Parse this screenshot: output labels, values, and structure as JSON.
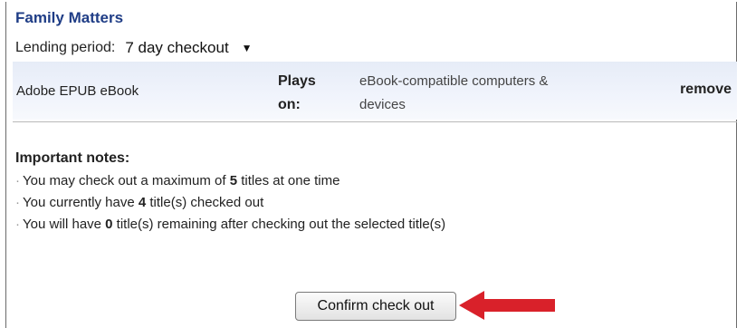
{
  "title": "Family Matters",
  "lending": {
    "label": "Lending period:",
    "value": "7 day checkout"
  },
  "item": {
    "format": "Adobe EPUB eBook",
    "plays_label_line1": "Plays",
    "plays_label_line2": "on:",
    "devices_line1": "eBook-compatible computers &",
    "devices_line2": "devices",
    "remove_label": "remove"
  },
  "notes": {
    "title": "Important notes:",
    "lines": [
      {
        "pre": "You may check out a maximum of ",
        "num": "5",
        "post": " titles at one time"
      },
      {
        "pre": "You currently have ",
        "num": "4",
        "post": " title(s) checked out"
      },
      {
        "pre": "You will have ",
        "num": "0",
        "post": " title(s) remaining after checking out the selected title(s)"
      }
    ]
  },
  "confirm_button": "Confirm check out",
  "colors": {
    "title": "#1f3d86",
    "row_highlight": "#e9eef8",
    "arrow": "#d9212a"
  },
  "icons": {
    "dropdown": "chevron-down-icon",
    "pointer": "red-arrow-icon"
  }
}
